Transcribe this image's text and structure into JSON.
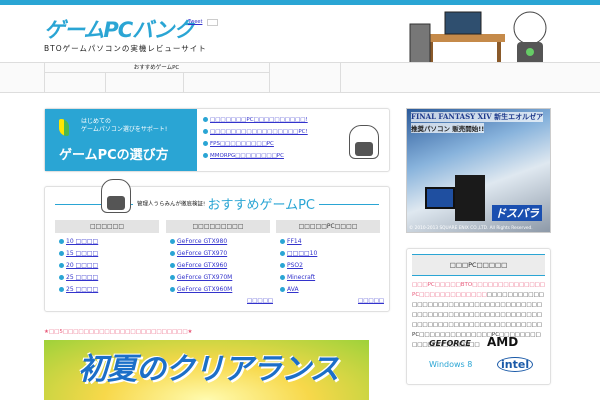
{
  "header": {
    "logo": "ゲームPCバンク",
    "tagline": "BTOゲームパソコンの実機レビューサイト",
    "tweet": "Tweet"
  },
  "nav": {
    "recommended": "おすすめゲームPC"
  },
  "guide": {
    "small_line1": "はじめての",
    "small_line2": "ゲームパソコン選びをサポート!",
    "big": "ゲームPCの選び方",
    "links": [
      "□□□□□□□PC□□□□□□□□□□!",
      "□□□□□□□□□□□□□□□□□PC!",
      "FPS□□□□□□□□□PC",
      "MMORPG□□□□□□□□PC"
    ]
  },
  "reco": {
    "pre": "管理人うらみんが徹底検証!",
    "title": "おすすめゲームPC",
    "columns": [
      {
        "header": "□□□□□□",
        "items": [
          "10 □□□□",
          "15 □□□□",
          "20 □□□□",
          "25 □□□□",
          "25 □□□□"
        ]
      },
      {
        "header": "□□□□□□□□□",
        "items": [
          "GeForce GTX980",
          "GeForce GTX970",
          "GeForce GTX960",
          "GeForce GTX970M",
          "GeForce GTX960M"
        ],
        "more": "□□□□□"
      },
      {
        "header": "□□□□□PC□□□□",
        "items": [
          "FF14",
          "□□□□10",
          "PSO2",
          "Minecraft",
          "AVA"
        ],
        "more": "□□□□□"
      }
    ]
  },
  "ad": {
    "title": "FINAL FANTASY XIV 新生エオルゼア",
    "sub": "推奨パソコン 販売開始!!",
    "brand": "ドスパラ",
    "copyright": "© 2010-2013 SQUARE ENIX CO.,LTD. All Rights Reserved."
  },
  "sidebar": {
    "title": "□□□PC□□□□□",
    "body_pink": "□□□PC□□□□□BTO□□□□□□□□□□□□□□PC□□□□□□□□□□□□□",
    "body": "□□□□□□□□□□□□□□□□□□□□□□□□□□□□□□□□□□□□□□□□□□□□□□□□□□□□□□□□□□□□□□□□□□□□□□□□□□□□□□□□□□□□□□PC□□□□□□□□□□□□□□PC□□□□□□□□□□□□□□□□□□□□□",
    "brands": [
      "GEFORCE",
      "AMD",
      "Windows 8",
      "intel"
    ]
  },
  "promo": {
    "text": "★□□5□□□□□□□□□□□□□□□□□□□□□□□□★",
    "banner": "初夏のクリアランス"
  },
  "colors": {
    "accent": "#2aa5d4",
    "pink": "#e85a7a"
  }
}
